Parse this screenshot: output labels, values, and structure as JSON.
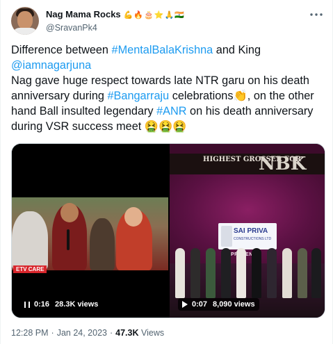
{
  "author": {
    "display_name": "Nag Mama Rocks",
    "name_emojis": "💪🔥🎂⭐🙏🇮🇳",
    "handle": "@SravanPk4"
  },
  "more_icon": "more-horizontal-icon",
  "tweet": {
    "line1_prefix": "Difference between ",
    "hashtag_mental": "#MentalBalaKrishna",
    "line1_mid": " and King",
    "mention_nag": "@iamnagarjuna",
    "line2_prefix": "Nag gave huge respect towards late NTR garu on his death anniversary during ",
    "hashtag_bangarraju": "#Bangarraju",
    "line2_suffix": " celebrations👏, on the other hand Ball insulted legendary ",
    "hashtag_anr": "#ANR",
    "line3_suffix": " on his death anniversary during VSR success meet 🤮🤮🤮"
  },
  "videos": [
    {
      "state_icon": "pause-icon",
      "time": "0:16",
      "views": "28.3K views",
      "overlay_text": "ETV CARE"
    },
    {
      "state_icon": "play-icon",
      "time": "0:07",
      "views": "8,090 views",
      "banner_text": "HIGHEST GROSSER FOR",
      "banner_big": "NBK",
      "logo_title": "SAI PRIVA",
      "logo_subtitle": "CONSTRUCTIONS LTD",
      "presents": "PRESENTS"
    }
  ],
  "footer": {
    "time": "12:28 PM",
    "date": "Jan 24, 2023",
    "views_count": "47.3K",
    "views_label": "Views",
    "separator": "·"
  },
  "colors": {
    "link": "#1d9bf0",
    "text": "#0f1419",
    "secondary": "#536471"
  }
}
